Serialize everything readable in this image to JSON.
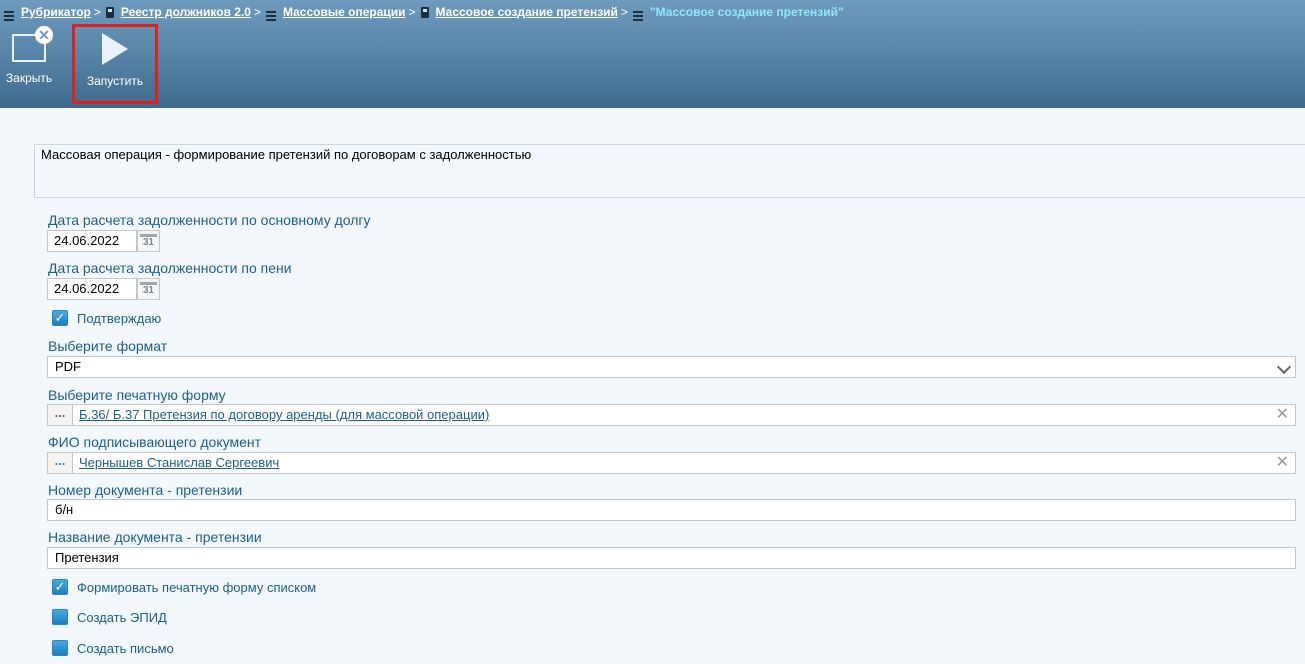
{
  "breadcrumb": {
    "items": [
      {
        "label": "Рубрикатор",
        "icon": "list-icon"
      },
      {
        "label": "Реестр должников 2.0",
        "icon": "doc-icon"
      },
      {
        "label": "Массовые операции",
        "icon": "list-icon"
      },
      {
        "label": "Массовое создание претензий",
        "icon": "doc-icon"
      }
    ],
    "separator": ">",
    "current": "\"Массовое создание претензий\""
  },
  "toolbar": {
    "close_label": "Закрыть",
    "run_label": "Запустить"
  },
  "form": {
    "description": "Массовая операция - формирование претензий по договорам с задолженностью",
    "debt_date_label": "Дата расчета задолженности по основному долгу",
    "debt_date_value": "24.06.2022",
    "penalty_date_label": "Дата расчета задолженности по пени",
    "penalty_date_value": "24.06.2022",
    "calendar_glyph": "31",
    "confirm_label": "Подтверждаю",
    "confirm_checked": true,
    "format_label": "Выберите формат",
    "format_value": "PDF",
    "print_form_label": "Выберите печатную форму",
    "print_form_button": "...",
    "print_form_value": "Б.36/ Б.37 Претензия по договору аренды (для массовой операции)",
    "signer_label": "ФИО подписывающего документ",
    "signer_button": "...",
    "signer_value": "Чернышев Станислав Сергеевич",
    "doc_number_label": "Номер документа - претензии",
    "doc_number_value": "б/н",
    "doc_name_label": "Название документа - претензии",
    "doc_name_value": "Претензия",
    "list_print_label": "Формировать печатную форму списком",
    "list_print_checked": true,
    "create_epid_label": "Создать ЭПИД",
    "create_epid_checked": false,
    "create_letter_label": "Создать письмо",
    "create_letter_checked": false,
    "clear_glyph": "✕",
    "check_glyph": "✓"
  },
  "colors": {
    "header_top": "#6e9bbd",
    "header_bottom": "#3f6a8d",
    "label_blue": "#1e5f8e",
    "highlight_red": "#e02020",
    "breadcrumb_current": "#8fe8ff"
  }
}
